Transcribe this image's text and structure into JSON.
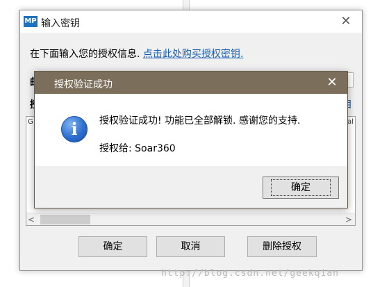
{
  "main_window": {
    "icon_text": "MP",
    "title": "输入密钥",
    "close_glyph": "✕",
    "prompt_text": "在下面输入您的授权信息. ",
    "buy_link": "点击此处购买授权密钥.",
    "behind_label_1": "邮",
    "behind_label_2": "授",
    "behind_link": "目",
    "key_area_fragment_left": "G",
    "key_area_fragment_right": "al",
    "scroll_left": "<",
    "scroll_right": ">",
    "buttons": {
      "ok": "确定",
      "cancel": "取消",
      "remove": "删除授权"
    }
  },
  "popup": {
    "title": "授权验证成功",
    "close_glyph": "✕",
    "icon_glyph": "i",
    "message": "授权验证成功! 功能已全部解锁. 感谢您的支持.",
    "licensee": "授权给: Soar360",
    "ok_label": "确定"
  },
  "watermark": "http://blog.csdn.net/geekqian",
  "colors": {
    "popup_titlebar": "#7b6e5a",
    "link": "#1a5fb4",
    "app_icon": "#1e73be"
  }
}
